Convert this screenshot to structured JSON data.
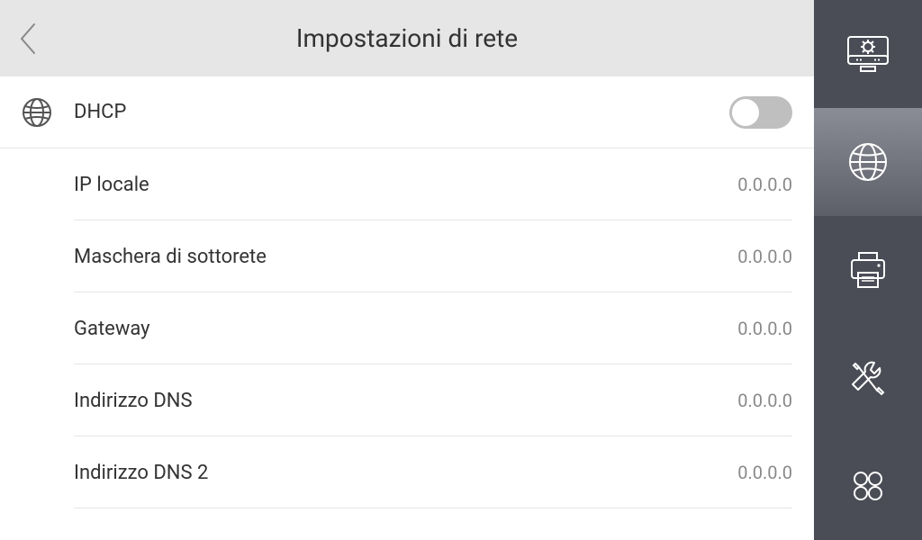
{
  "header": {
    "title": "Impostazioni di rete"
  },
  "dhcp": {
    "label": "DHCP",
    "enabled": false
  },
  "rows": [
    {
      "label": "IP locale",
      "value": "0.0.0.0"
    },
    {
      "label": "Maschera di sottorete",
      "value": "0.0.0.0"
    },
    {
      "label": "Gateway",
      "value": "0.0.0.0"
    },
    {
      "label": "Indirizzo DNS",
      "value": "0.0.0.0"
    },
    {
      "label": "Indirizzo DNS 2",
      "value": "0.0.0.0"
    }
  ],
  "sidebar": [
    {
      "name": "system-settings",
      "icon": "monitor-gear",
      "active": false
    },
    {
      "name": "network",
      "icon": "globe",
      "active": true
    },
    {
      "name": "printer",
      "icon": "printer",
      "active": false
    },
    {
      "name": "tools",
      "icon": "tools",
      "active": false
    },
    {
      "name": "apps",
      "icon": "apps",
      "active": false
    }
  ],
  "colors": {
    "sidebarBg": "#4a4c56",
    "sidebarActive": "#8a8c96",
    "headerBg": "#e6e6e6"
  }
}
